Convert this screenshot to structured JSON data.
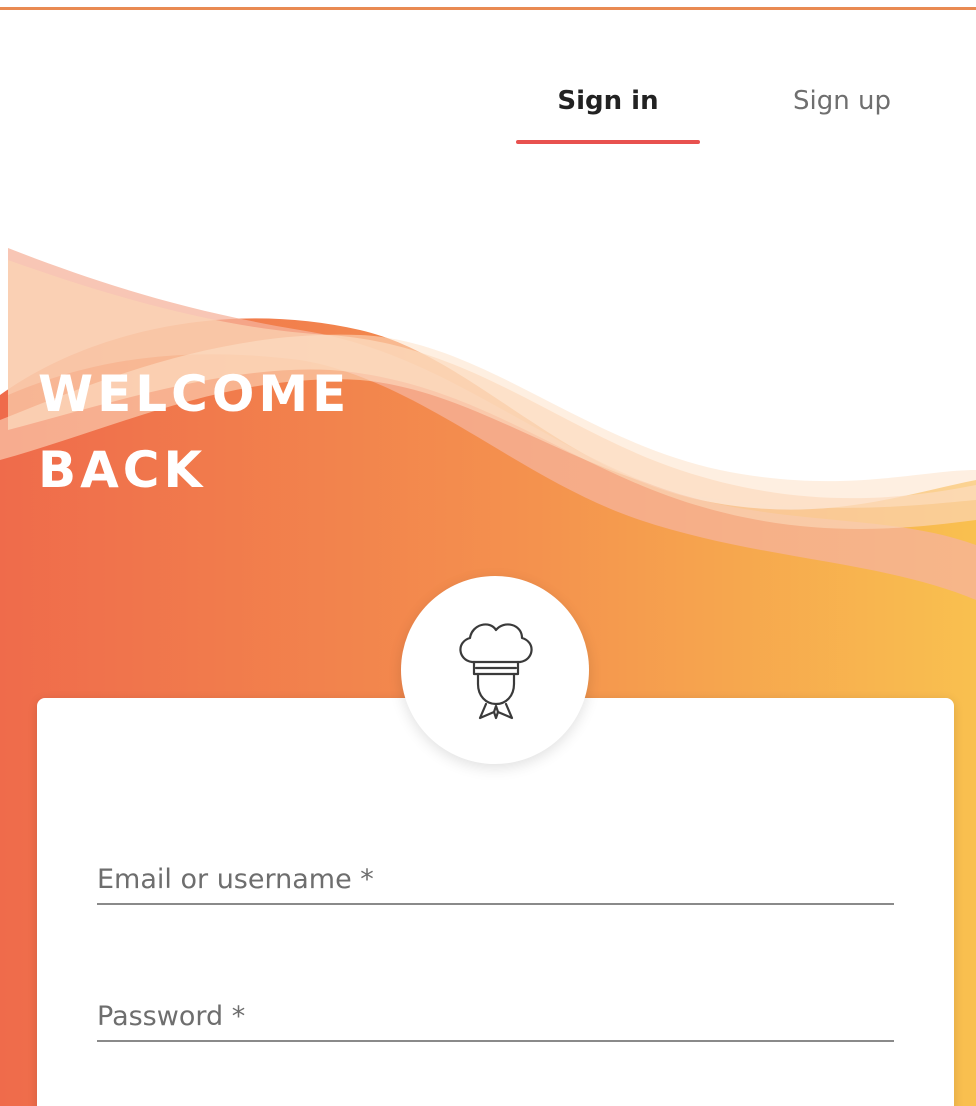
{
  "tabs": {
    "signin_label": "Sign in",
    "signup_label": "Sign up"
  },
  "hero": {
    "line1": "WELCOME",
    "line2": "BACK"
  },
  "form": {
    "email_placeholder": "Email or username *",
    "password_placeholder": "Password *"
  },
  "colors": {
    "accent": "#e8514f",
    "gradient_start": "#ee6a4a",
    "gradient_end": "#f8c24e"
  },
  "icons": {
    "avatar": "chef-icon"
  }
}
